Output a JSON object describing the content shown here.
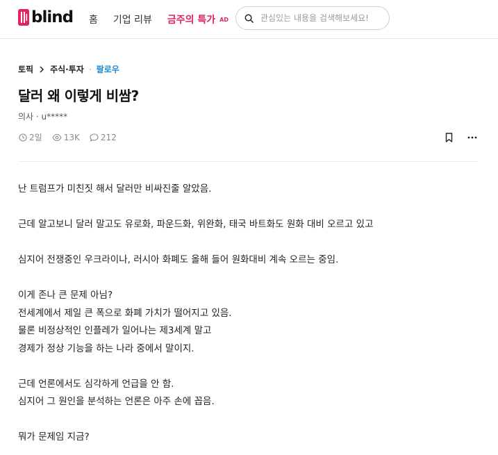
{
  "header": {
    "logo_text": "blind",
    "nav": [
      {
        "label": "홈"
      },
      {
        "label": "기업 리뷰"
      },
      {
        "label": "금주의 특가",
        "badge": "AD"
      }
    ],
    "search": {
      "placeholder": "관심있는 내용을 검색해보세요!"
    }
  },
  "breadcrumb": {
    "root": "토픽",
    "channel": "주식·투자",
    "follow": "팔로우"
  },
  "post": {
    "title": "달러 왜 이렇게 비쌈?",
    "author": "의사 · u*****",
    "time": "2일",
    "views": "13K",
    "comments": "212",
    "paragraphs": [
      [
        "난 트럼프가 미친짓 해서 달러만 비싸진줄 알았음."
      ],
      [
        "근데 알고보니 달러 말고도 유로화, 파운드화, 위완화, 태국 바트화도 원화 대비 오르고 있고"
      ],
      [
        "심지어 전쟁중인 우크라이나, 러시아 화폐도 올해 들어 원화대비 계속 오르는 중임."
      ],
      [
        "이게 존나 큰 문제 아님?",
        "전세계에서 제일 큰 폭으로 화폐 가치가 떨어지고 있음.",
        "물론 비정상적인 인플레가 일어나는 제3세계 말고",
        "경제가 정상 기능을 하는 나라 중에서 말이지."
      ],
      [
        "근데 언론에서도 심각하게 언급을 안 함.",
        "심지어 그 원인을 분석하는 언론은 아주 손에 꼽음."
      ],
      [
        "뭐가 문제임 지금?"
      ]
    ]
  },
  "colors": {
    "brand": "#e0245e",
    "follow": "#1f8ad6",
    "meta": "#8a8a8a"
  }
}
